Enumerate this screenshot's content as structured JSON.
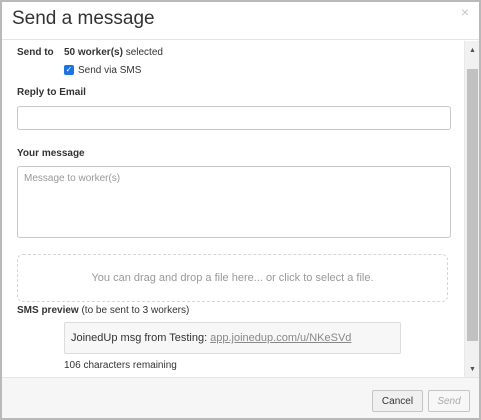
{
  "header": {
    "title": "Send a message",
    "close_glyph": "×"
  },
  "send_to": {
    "label": "Send to",
    "count_text": "50 worker(s)",
    "suffix": " selected"
  },
  "sms_option": {
    "checked": true,
    "label": "Send via SMS"
  },
  "reply_to_email": {
    "label": "Reply to Email",
    "value": "",
    "placeholder": ""
  },
  "message": {
    "label": "Your message",
    "placeholder": "Message to worker(s)"
  },
  "dropzone": {
    "text": "You can drag and drop a file here... or click to select a file."
  },
  "sms_preview": {
    "title": "SMS preview",
    "subtitle": " (to be sent to 3 workers)",
    "message_text": "JoinedUp msg from Testing:",
    "link_text": "app.joinedup.com/u/NKeSVd",
    "chars_remaining": "106 characters remaining"
  },
  "footer": {
    "cancel_label": "Cancel",
    "send_label": "Send"
  },
  "colors": {
    "checkbox": "#1a73e8",
    "footer_bg": "#f6f6f6"
  },
  "icons": {
    "close": "close-icon",
    "check": "checkmark-icon",
    "scroll_up": "arrow-up-icon",
    "scroll_down": "arrow-down-icon"
  }
}
